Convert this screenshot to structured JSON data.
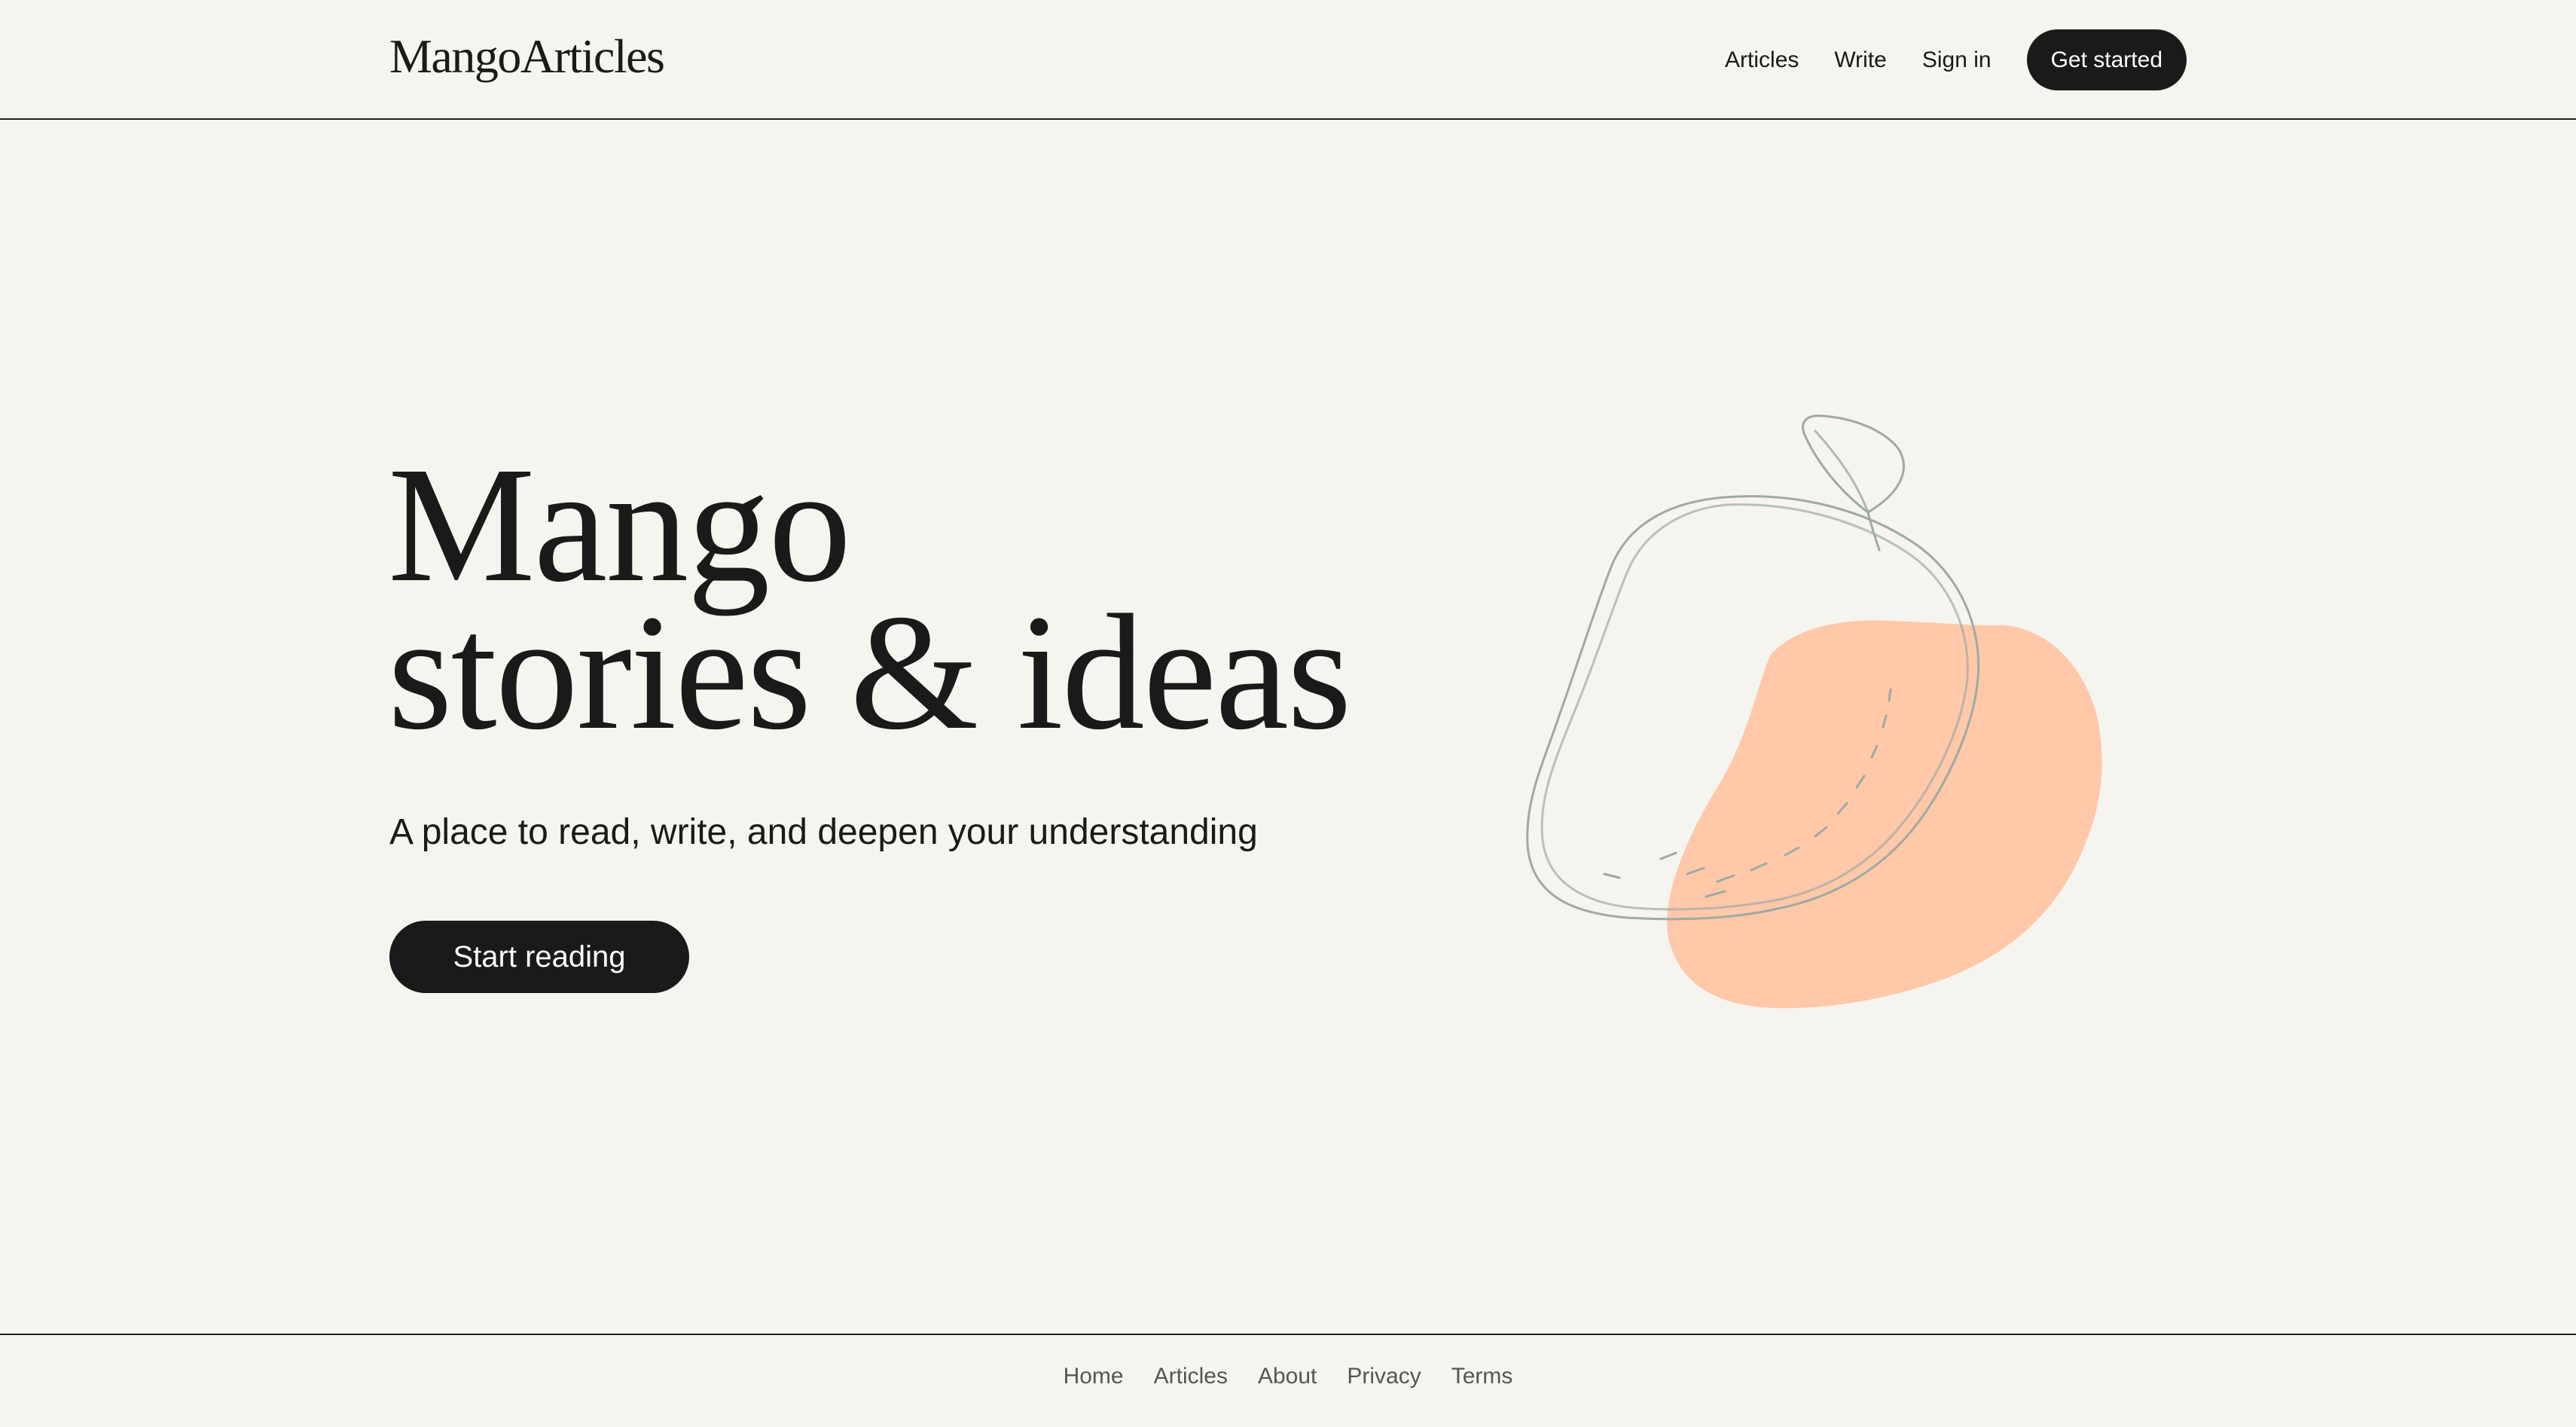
{
  "header": {
    "logo": "MangoArticles",
    "nav": {
      "articles": "Articles",
      "write": "Write",
      "sign_in": "Sign in",
      "get_started": "Get started"
    }
  },
  "hero": {
    "title_line1": "Mango",
    "title_line2": "stories & ideas",
    "subtitle": "A place to read, write, and deepen your understanding",
    "cta": "Start reading",
    "illustration": "mango-illustration"
  },
  "footer": {
    "links": [
      "Home",
      "Articles",
      "About",
      "Privacy",
      "Terms"
    ]
  },
  "colors": {
    "background": "#F5F4EF",
    "text": "#1A1A1A",
    "button": "#1A1A1A",
    "mango_fill": "#FFC5A4",
    "sketch_line": "#9FA9A5",
    "footer_text": "#555555"
  }
}
